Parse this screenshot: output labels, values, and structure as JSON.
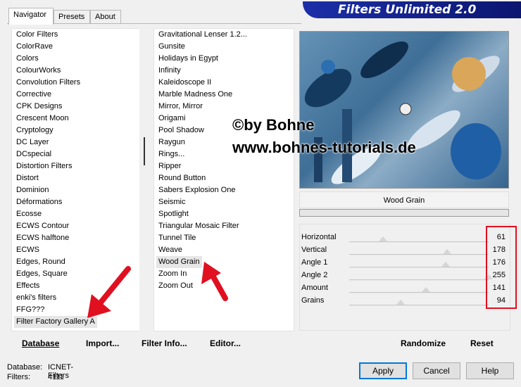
{
  "tabs": [
    {
      "label": "Navigator"
    },
    {
      "label": "Presets"
    },
    {
      "label": "About"
    }
  ],
  "banner_title": "Filters Unlimited 2.0",
  "categories": [
    "Color Filters",
    "ColorRave",
    "Colors",
    "ColourWorks",
    "Convolution Filters",
    "Corrective",
    "CPK Designs",
    "Crescent Moon",
    "Cryptology",
    "DC Layer",
    "DCspecial",
    "Distortion Filters",
    "Distort",
    "Dominion",
    "Déformations",
    "Ecosse",
    "ECWS Contour",
    "ECWS halftone",
    "ECWS",
    "Edges, Round",
    "Edges, Square",
    "Effects",
    "enki's filters",
    "FFG???",
    "Filter Factory Gallery A"
  ],
  "selected_category": "Filter Factory Gallery A",
  "filters": [
    "Gravitational Lenser 1.2...",
    "Gunsite",
    "Holidays in Egypt",
    "Infinity",
    "Kaleidoscope II",
    "Marble Madness One",
    "Mirror, Mirror",
    "Origami",
    "Pool Shadow",
    "Raygun",
    "Rings...",
    "Ripper",
    "Round Button",
    "Sabers Explosion One",
    "Seismic",
    "Spotlight",
    "Triangular Mosaic Filter",
    "Tunnel Tile",
    "Weave",
    "Wood Grain",
    "Zoom In",
    "Zoom Out"
  ],
  "selected_filter": "Wood Grain",
  "watermark": {
    "line1": "©by Bohne",
    "line2": "www.bohnes-tutorials.de"
  },
  "current_filter_name": "Wood Grain",
  "params": [
    {
      "label": "Horizontal",
      "value": "61",
      "fraction": 0.24
    },
    {
      "label": "Vertical",
      "value": "178",
      "fraction": 0.7
    },
    {
      "label": "Angle 1",
      "value": "176",
      "fraction": 0.69
    },
    {
      "label": "Angle 2",
      "value": "255",
      "fraction": 1.0
    },
    {
      "label": "Amount",
      "value": "141",
      "fraction": 0.55
    },
    {
      "label": "Grains",
      "value": "94",
      "fraction": 0.37
    }
  ],
  "bottom_buttons": {
    "database": "Database",
    "import": "Import...",
    "filter_info": "Filter Info...",
    "editor": "Editor...",
    "randomize": "Randomize",
    "reset": "Reset"
  },
  "info": {
    "database_label": "Database:",
    "database_value": "ICNET-Filters",
    "filters_label": "Filters:",
    "filters_value": "4111"
  },
  "dialog_buttons": {
    "apply": "Apply",
    "cancel": "Cancel",
    "help": "Help"
  },
  "colors": {
    "banner": "#0b1670",
    "highlight_box": "#e01020",
    "arrow": "#e01020"
  }
}
